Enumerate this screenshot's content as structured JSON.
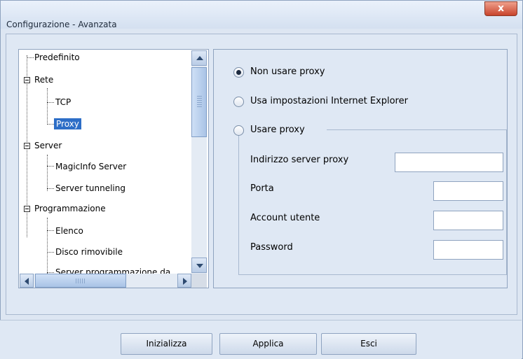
{
  "window": {
    "title": "Configurazione - Avanzata",
    "close_glyph": "x"
  },
  "tree": {
    "items": [
      {
        "label": "Predefinito"
      },
      {
        "label": "Rete"
      },
      {
        "label": "TCP"
      },
      {
        "label": "Proxy"
      },
      {
        "label": "Server"
      },
      {
        "label": "MagicInfo Server"
      },
      {
        "label": "Server tunneling"
      },
      {
        "label": "Programmazione"
      },
      {
        "label": "Elenco"
      },
      {
        "label": "Disco rimovibile"
      },
      {
        "label": "Server programmazione da"
      }
    ],
    "selected": "Proxy"
  },
  "proxy": {
    "options": [
      {
        "label": "Non usare proxy",
        "selected": true
      },
      {
        "label": "Usa impostazioni Internet Explorer",
        "selected": false
      },
      {
        "label": "Usare proxy",
        "selected": false
      }
    ],
    "fields": [
      {
        "label": "Indirizzo server proxy",
        "value": ""
      },
      {
        "label": "Porta",
        "value": ""
      },
      {
        "label": "Account utente",
        "value": ""
      },
      {
        "label": "Password",
        "value": ""
      }
    ]
  },
  "buttons": {
    "reset": "Inizializza",
    "apply": "Applica",
    "exit": "Esci"
  },
  "colors": {
    "selection": "#2d6ec7",
    "background": "#dfe8f4"
  }
}
